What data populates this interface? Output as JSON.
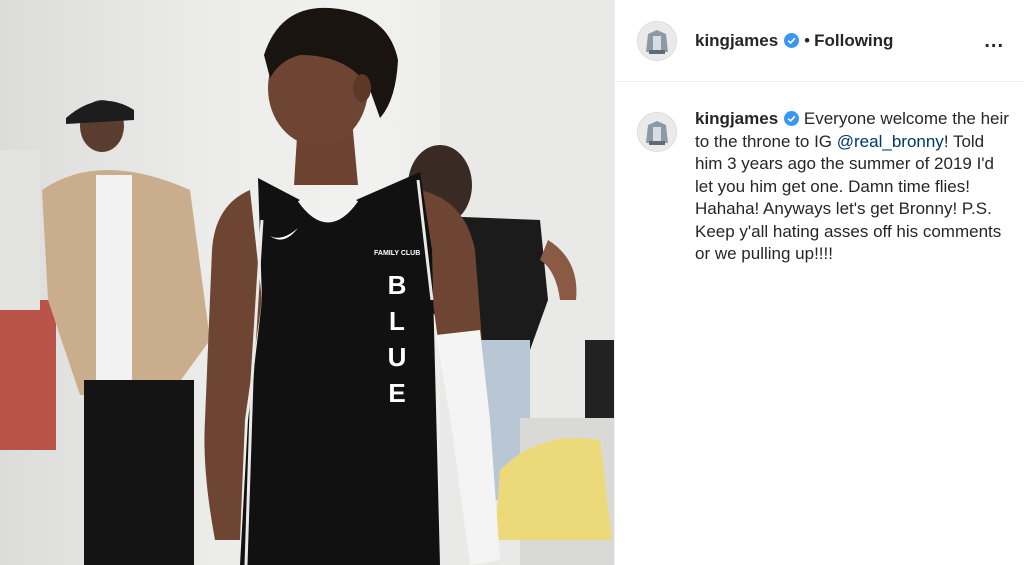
{
  "post": {
    "photo": {
      "jersey_text": "BLUE",
      "jersey_patch": "FAMILY CLUB",
      "brand_icon": "nike-swoosh-icon"
    },
    "header": {
      "username": "kingjames",
      "verified_icon": "verified-badge-icon",
      "separator": "•",
      "follow_status": "Following",
      "more_label": "..."
    },
    "caption": {
      "username": "kingjames",
      "text_before_mention": " Everyone welcome the heir to the throne to IG ",
      "mention": "@real_bronny",
      "text_after_mention": "! Told him 3 years ago the summer of 2019 I'd let you him get one. Damn time flies! Hahaha! Anyways let's get Bronny! P.S. Keep y'all hating asses off his comments or we pulling up!!!!"
    }
  },
  "colors": {
    "jersey": "#111111",
    "verified": "#3897f0",
    "mention": "#00376b",
    "text": "#262626"
  }
}
